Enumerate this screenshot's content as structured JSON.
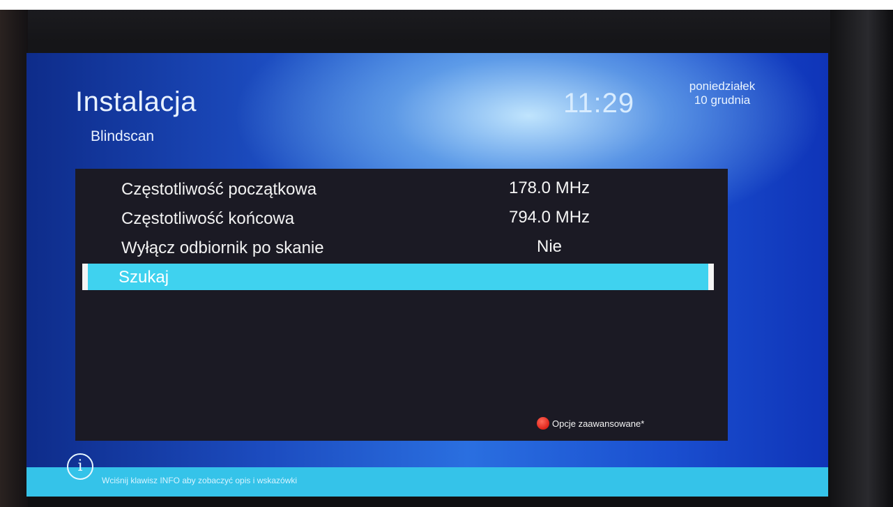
{
  "header": {
    "title": "Instalacja",
    "subtitle": "Blindscan",
    "time": "11:29",
    "day": "poniedziałek",
    "date": "10 grudnia"
  },
  "menu": {
    "items": [
      {
        "label": "Częstotliwość początkowa",
        "value": "178.0 MHz"
      },
      {
        "label": "Częstotliwość końcowa",
        "value": "794.0 MHz"
      },
      {
        "label": "Wyłącz odbiornik po skanie",
        "value": "Nie"
      }
    ],
    "selected": {
      "label": "Szukaj"
    },
    "red_option": "Opcje zaawansowane*"
  },
  "info": {
    "icon": "info-icon",
    "text": "Wciśnij klawisz INFO aby zobaczyć opis i wskazówki"
  },
  "colors": {
    "highlight": "#3fd2ef",
    "red_button": "#e0241a",
    "panel": "#1b1a24"
  }
}
